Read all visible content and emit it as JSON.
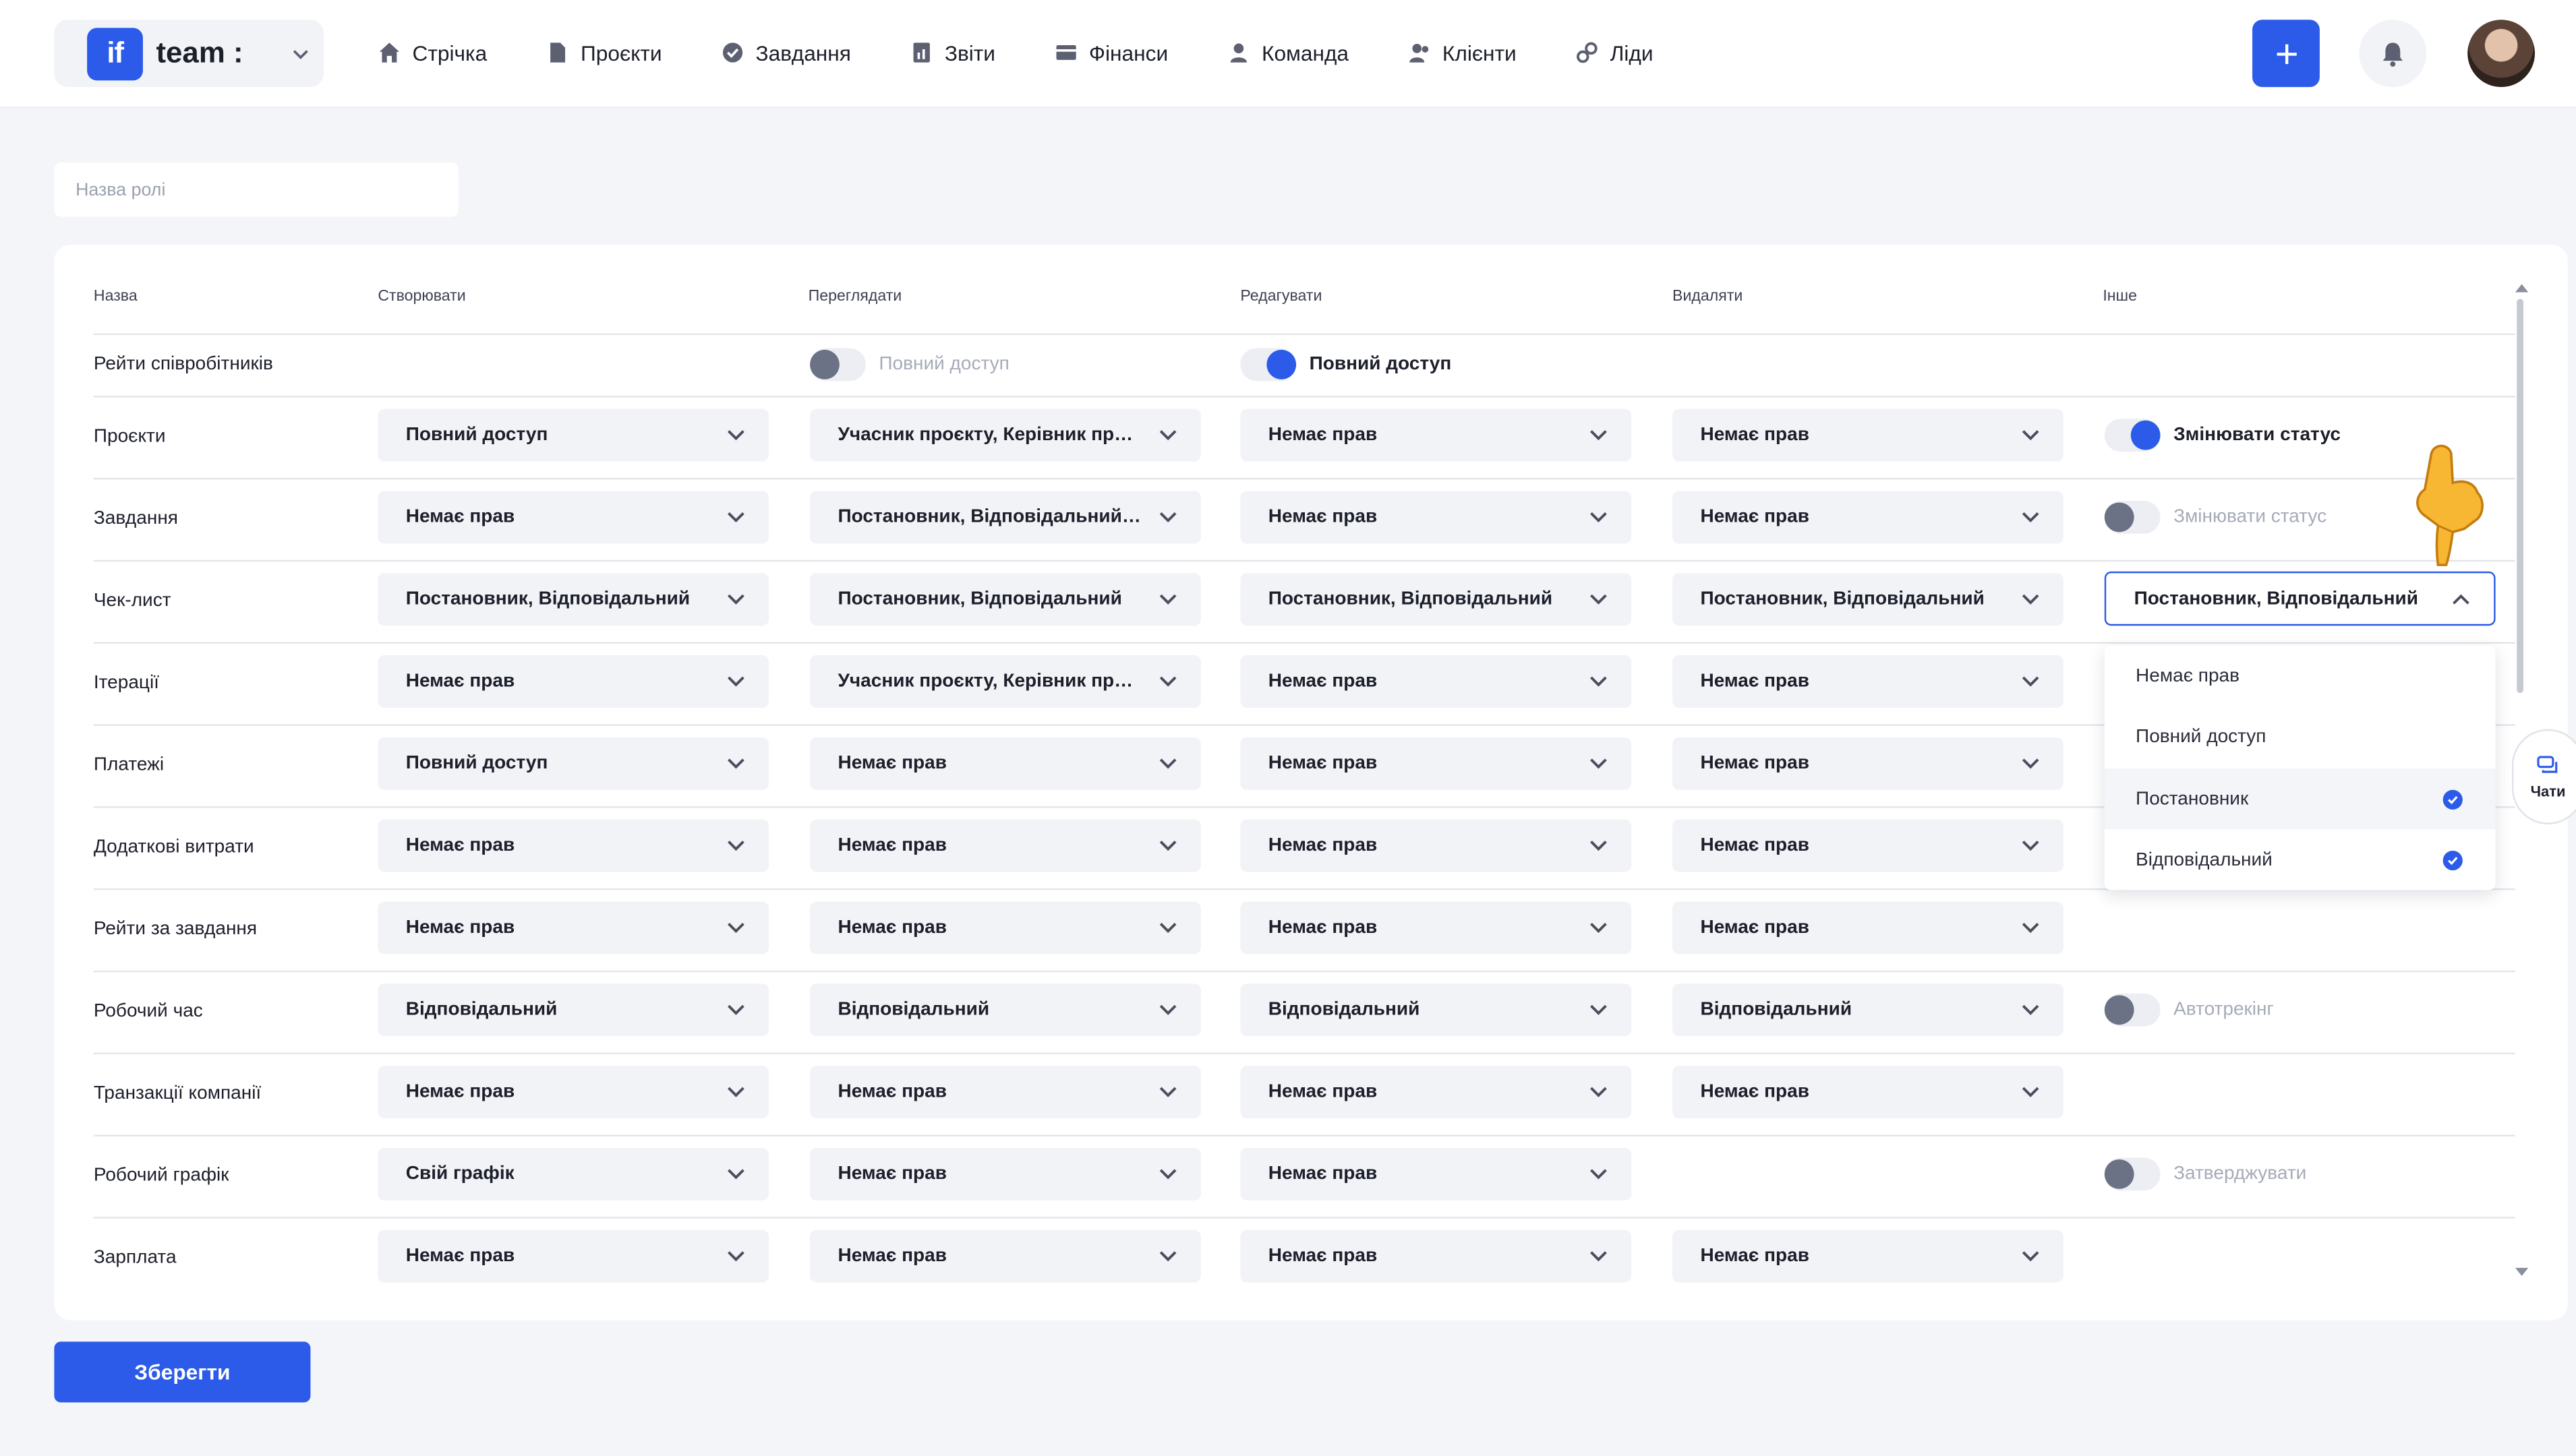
{
  "app": {
    "logo_text": "if",
    "name": "team :"
  },
  "nav": [
    {
      "label": "Стрічка",
      "icon": "home-icon"
    },
    {
      "label": "Проєкти",
      "icon": "document-icon"
    },
    {
      "label": "Завдання",
      "icon": "check-circle-icon"
    },
    {
      "label": "Звіти",
      "icon": "report-icon"
    },
    {
      "label": "Фінанси",
      "icon": "wallet-icon"
    },
    {
      "label": "Команда",
      "icon": "user-icon"
    },
    {
      "label": "Клієнти",
      "icon": "users-icon"
    },
    {
      "label": "Ліди",
      "icon": "link-icon"
    }
  ],
  "role_input": {
    "placeholder": "Назва ролі",
    "value": ""
  },
  "table": {
    "headers": [
      "Назва",
      "Створювати",
      "Переглядати",
      "Редагувати",
      "Видаляти",
      "Інше"
    ],
    "top_row": {
      "name": "Рейти співробітників",
      "view_toggle": {
        "label": "Повний доступ",
        "on": false
      },
      "edit_toggle": {
        "label": "Повний доступ",
        "on": true
      }
    },
    "rows": [
      {
        "name": "Проєкти",
        "create": "Повний доступ",
        "view": "Учасник проєкту, Керівник проєкту",
        "edit": "Немає прав",
        "delete": "Немає прав",
        "other_toggle": {
          "label": "Змінювати статус",
          "on": true
        }
      },
      {
        "name": "Завдання",
        "create": "Немає прав",
        "view": "Постановник, Відповідальний, Спостерігач",
        "edit": "Немає прав",
        "delete": "Немає прав",
        "other_toggle": {
          "label": "Змінювати статус",
          "on": false
        }
      },
      {
        "name": "Чек-лист",
        "create": "Постановник, Відповідальний",
        "view": "Постановник, Відповідальний",
        "edit": "Постановник, Відповідальний",
        "delete": "Постановник, Відповідальний",
        "other_select": "Постановник, Відповідальний"
      },
      {
        "name": "Ітерації",
        "create": "Немає прав",
        "view": "Учасник проєкту, Керівник проєкту",
        "edit": "Немає прав",
        "delete": "Немає прав"
      },
      {
        "name": "Платежі",
        "create": "Повний доступ",
        "view": "Немає прав",
        "edit": "Немає прав",
        "delete": "Немає прав"
      },
      {
        "name": "Додаткові витрати",
        "create": "Немає прав",
        "view": "Немає прав",
        "edit": "Немає прав",
        "delete": "Немає прав"
      },
      {
        "name": "Рейти за завдання",
        "create": "Немає прав",
        "view": "Немає прав",
        "edit": "Немає прав",
        "delete": "Немає прав"
      },
      {
        "name": "Робочий час",
        "create": "Відповідальний",
        "view": "Відповідальний",
        "edit": "Відповідальний",
        "delete": "Відповідальний",
        "other_toggle": {
          "label": "Автотрекінг",
          "on": false
        }
      },
      {
        "name": "Транзакції компанії",
        "create": "Немає прав",
        "view": "Немає прав",
        "edit": "Немає прав",
        "delete": "Немає прав"
      },
      {
        "name": "Робочий графік",
        "create": "Свій графік",
        "view": "Немає прав",
        "edit": "Немає прав",
        "other_toggle": {
          "label": "Затверджувати",
          "on": false
        }
      },
      {
        "name": "Зарплата",
        "create": "Немає прав",
        "view": "Немає прав",
        "edit": "Немає прав",
        "delete": "Немає прав"
      }
    ]
  },
  "dropdown": {
    "options": [
      {
        "label": "Немає прав",
        "checked": false
      },
      {
        "label": "Повний доступ",
        "checked": false
      },
      {
        "label": "Постановник",
        "checked": true
      },
      {
        "label": "Відповідальний",
        "checked": true
      }
    ]
  },
  "chat_button": {
    "label": "Чати"
  },
  "save_button": {
    "label": "Зберегти"
  },
  "colors": {
    "accent": "#2b5be8",
    "background": "#f4f5f8",
    "select_bg": "#f1f3f7"
  }
}
